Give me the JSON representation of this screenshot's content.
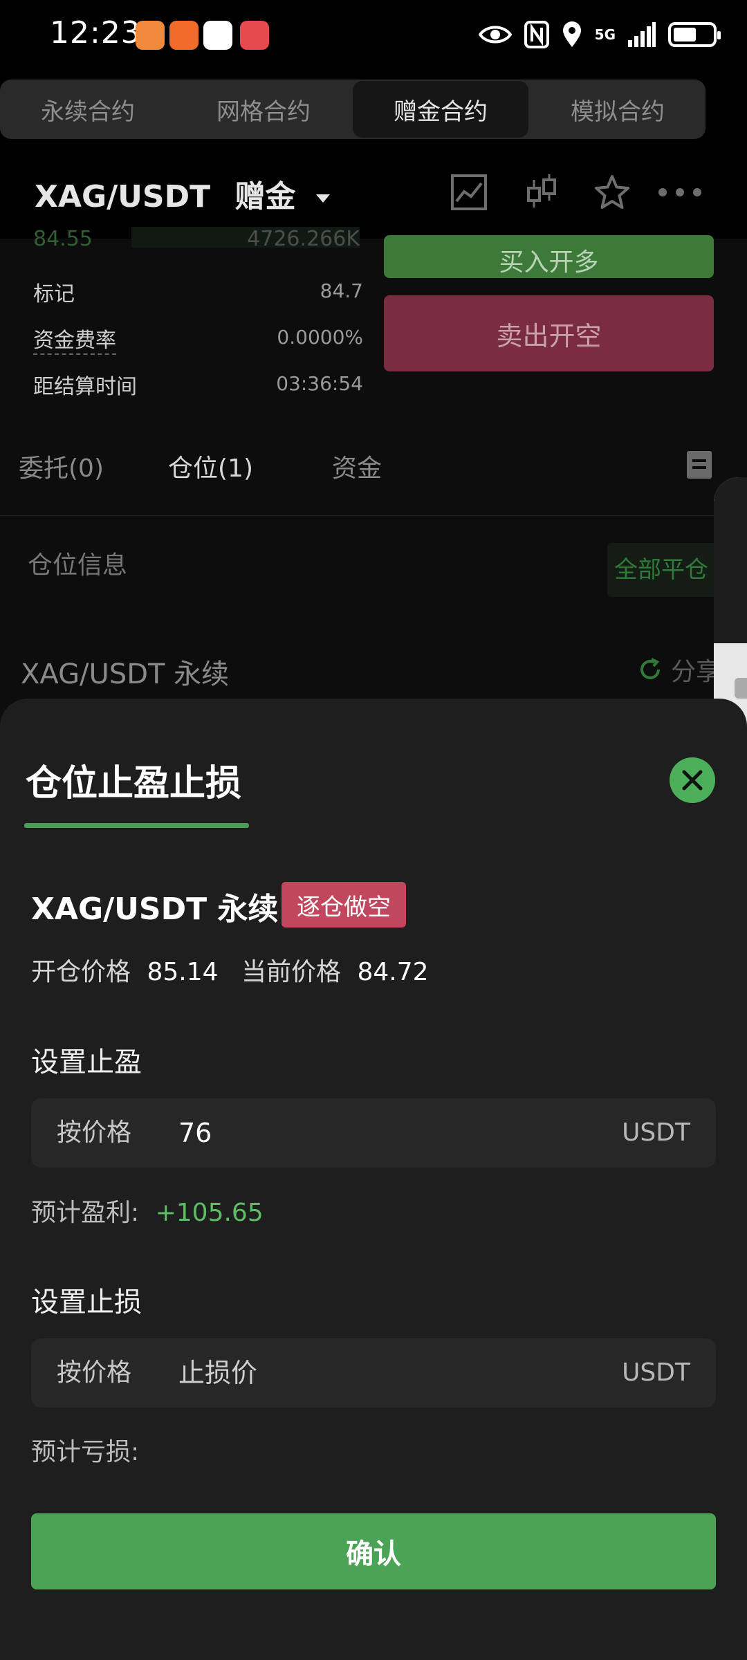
{
  "status_bar": {
    "time": "12:23",
    "network": "5G"
  },
  "tabs": [
    {
      "label": "永续合约",
      "active": false
    },
    {
      "label": "网格合约",
      "active": false
    },
    {
      "label": "赠金合约",
      "active": true
    },
    {
      "label": "模拟合约",
      "active": false
    }
  ],
  "header": {
    "pair": "XAG/USDT",
    "mode": "赠金"
  },
  "background": {
    "clipped_price": "84.55",
    "clipped_volume": "4726.266K",
    "buy_label": "买入开多",
    "sell_label": "卖出开空",
    "stats": [
      {
        "label": "标记",
        "value": "84.7"
      },
      {
        "label": "资金费率",
        "value": "0.0000%"
      },
      {
        "label": "距结算时间",
        "value": "03:36:54"
      }
    ],
    "subtabs": [
      "委托(0)",
      "仓位(1)",
      "资金"
    ],
    "position_info_label": "仓位信息",
    "close_all_label": "全部平仓",
    "position_title": "XAG/USDT 永续",
    "share_label": "分享"
  },
  "sheet": {
    "title": "仓位止盈止损",
    "position_name": "XAG/USDT 永续",
    "badge": "逐仓做空",
    "open_price_label": "开仓价格",
    "open_price": "85.14",
    "current_price_label": "当前价格",
    "current_price": "84.72",
    "take_profit": {
      "title": "设置止盈",
      "mode": "按价格",
      "value": "76",
      "unit": "USDT",
      "estimate_label": "预计盈利:",
      "estimate_value": "+105.65"
    },
    "stop_loss": {
      "title": "设置止损",
      "mode": "按价格",
      "placeholder": "止损价",
      "unit": "USDT",
      "estimate_label": "预计亏损:"
    },
    "confirm_label": "确认"
  },
  "colors": {
    "accent_green": "#4ba356",
    "profit_green": "#5cbf63",
    "short_badge": "#c1475e",
    "sell_button": "#7a2c41"
  }
}
